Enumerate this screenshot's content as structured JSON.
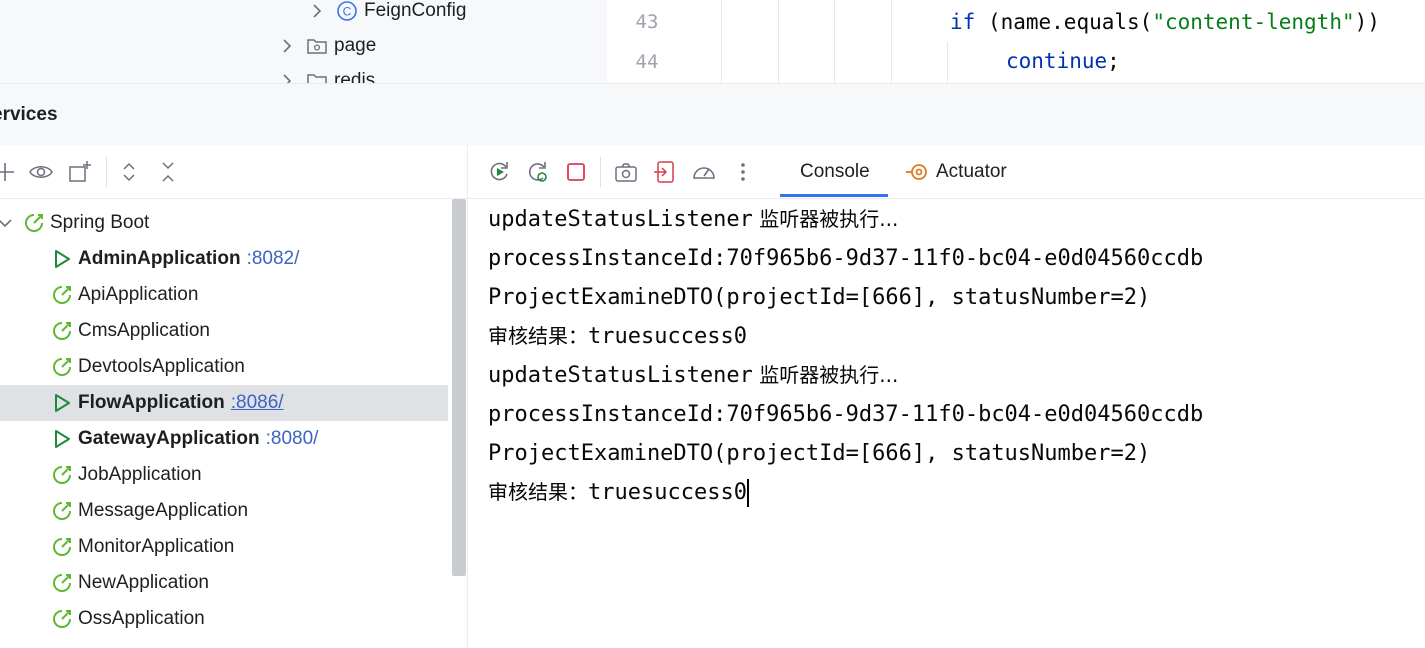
{
  "project_tree": {
    "items": [
      {
        "label": "FeignConfig",
        "icon": "class-icon"
      },
      {
        "label": "page",
        "icon": "folder-icon"
      },
      {
        "label": "redis",
        "icon": "folder-icon"
      }
    ]
  },
  "editor": {
    "lines": [
      {
        "number": "43",
        "keyword": "if",
        "text_before": " (name.equals(",
        "string": "\"content-length\"",
        "text_after": "))"
      },
      {
        "number": "44",
        "keyword": "continue",
        "text_after": ";"
      }
    ]
  },
  "services": {
    "title": "ervices",
    "toolbar_icons": [
      "add-icon",
      "eye-icon",
      "new-service-icon",
      "expand-all-icon",
      "collapse-all-icon"
    ],
    "group": {
      "label": "Spring Boot",
      "icon": "spring-boot-icon"
    },
    "apps": [
      {
        "name": "AdminApplication",
        "port": ":8082/",
        "running": true
      },
      {
        "name": "ApiApplication",
        "port": "",
        "running": false
      },
      {
        "name": "CmsApplication",
        "port": "",
        "running": false
      },
      {
        "name": "DevtoolsApplication",
        "port": "",
        "running": false
      },
      {
        "name": "FlowApplication",
        "port": ":8086/",
        "running": true,
        "selected": true
      },
      {
        "name": "GatewayApplication",
        "port": ":8080/",
        "running": true
      },
      {
        "name": "JobApplication",
        "port": "",
        "running": false
      },
      {
        "name": "MessageApplication",
        "port": "",
        "running": false
      },
      {
        "name": "MonitorApplication",
        "port": "",
        "running": false
      },
      {
        "name": "NewApplication",
        "port": "",
        "running": false
      },
      {
        "name": "OssApplication",
        "port": "",
        "running": false
      }
    ]
  },
  "run_toolbar": {
    "icons": [
      "rerun-icon",
      "rerun-debug-icon",
      "stop-icon",
      "screenshot-icon",
      "exit-icon",
      "dashboard-icon",
      "more-icon"
    ],
    "tabs": [
      {
        "label": "Console",
        "active": true
      },
      {
        "label": "Actuator",
        "active": false
      }
    ]
  },
  "console": {
    "lines": [
      {
        "text": "updateStatusListener",
        "cjk_suffix": " 监听器被执行..."
      },
      {
        "text": "processInstanceId:70f965b6-9d37-11f0-bc04-e0d04560ccdb"
      },
      {
        "text": "ProjectExamineDTO(projectId=[666], statusNumber=2)"
      },
      {
        "cjk_prefix": "审核结果：",
        "text": "truesuccess0"
      },
      {
        "text": "updateStatusListener",
        "cjk_suffix": " 监听器被执行..."
      },
      {
        "text": "processInstanceId:70f965b6-9d37-11f0-bc04-e0d04560ccdb"
      },
      {
        "text": "ProjectExamineDTO(projectId=[666], statusNumber=2)"
      },
      {
        "cjk_prefix": "审核结果：",
        "text": "truesuccess0"
      }
    ]
  },
  "colors": {
    "accent": "#3574f0",
    "run_green": "#208a3c",
    "spring_green": "#5fb832",
    "stop_red": "#db3b4b",
    "port_blue": "#3c64c4"
  }
}
